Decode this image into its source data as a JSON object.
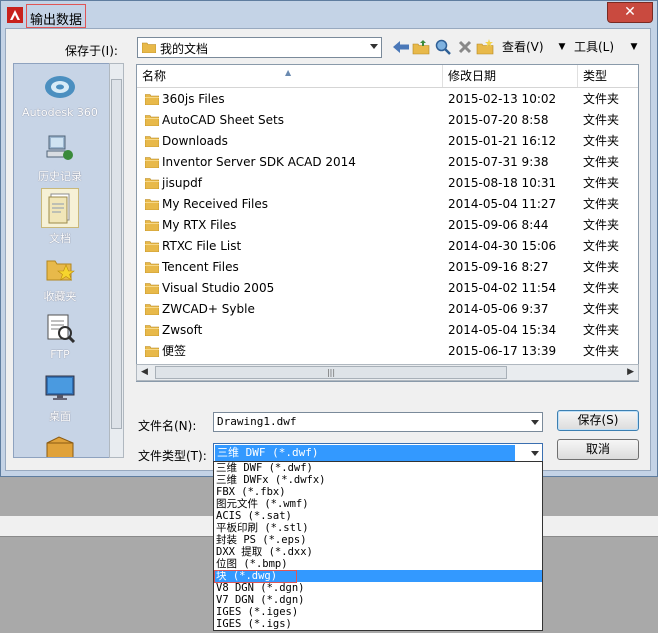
{
  "window": {
    "title": "输出数据",
    "close_glyph": "✕"
  },
  "toolbar": {
    "save_in_label": "保存于(I):",
    "current_folder": "我的文档",
    "view_label": "查看(V)",
    "tools_label": "工具(L)"
  },
  "places": [
    {
      "label": "Autodesk 360",
      "icon": "cloud-icon"
    },
    {
      "label": "历史记录",
      "icon": "history-icon"
    },
    {
      "label": "文档",
      "icon": "documents-icon",
      "active": true
    },
    {
      "label": "收藏夹",
      "icon": "favorites-icon"
    },
    {
      "label": "FTP",
      "icon": "ftp-icon"
    },
    {
      "label": "桌面",
      "icon": "desktop-icon"
    }
  ],
  "columns": {
    "name": "名称",
    "date": "修改日期",
    "type": "类型"
  },
  "files": [
    {
      "name": "360js Files",
      "date": "2015-02-13 10:02",
      "type": "文件夹"
    },
    {
      "name": "AutoCAD Sheet Sets",
      "date": "2015-07-20 8:58",
      "type": "文件夹"
    },
    {
      "name": "Downloads",
      "date": "2015-01-21 16:12",
      "type": "文件夹"
    },
    {
      "name": "Inventor Server SDK ACAD 2014",
      "date": "2015-07-31 9:38",
      "type": "文件夹"
    },
    {
      "name": "jisupdf",
      "date": "2015-08-18 10:31",
      "type": "文件夹"
    },
    {
      "name": "My Received Files",
      "date": "2014-05-04 11:27",
      "type": "文件夹"
    },
    {
      "name": "My RTX Files",
      "date": "2015-09-06 8:44",
      "type": "文件夹"
    },
    {
      "name": "RTXC File List",
      "date": "2014-04-30 15:06",
      "type": "文件夹"
    },
    {
      "name": "Tencent Files",
      "date": "2015-09-16 8:27",
      "type": "文件夹"
    },
    {
      "name": "Visual Studio 2005",
      "date": "2015-04-02 11:54",
      "type": "文件夹"
    },
    {
      "name": "ZWCAD+ Syble",
      "date": "2014-05-06 9:37",
      "type": "文件夹"
    },
    {
      "name": "Zwsoft",
      "date": "2014-05-04 15:34",
      "type": "文件夹"
    },
    {
      "name": "便签",
      "date": "2015-06-17 13:39",
      "type": "文件夹"
    }
  ],
  "form": {
    "filename_label": "文件名(N):",
    "filename_value": "Drawing1.dwf",
    "filetype_label": "文件类型(T):",
    "filetype_value": "三维 DWF (*.dwf)",
    "save_button": "保存(S)",
    "cancel_button": "取消"
  },
  "filetype_options": [
    "三维 DWF (*.dwf)",
    "三维 DWFx (*.dwfx)",
    "FBX (*.fbx)",
    "图元文件 (*.wmf)",
    "ACIS (*.sat)",
    "平板印刷 (*.stl)",
    "封装 PS (*.eps)",
    "DXX 提取 (*.dxx)",
    "位图 (*.bmp)",
    "块 (*.dwg)",
    "V8 DGN (*.dgn)",
    "V7 DGN (*.dgn)",
    "IGES (*.iges)",
    "IGES (*.igs)"
  ],
  "highlighted_option_index": 9,
  "colors": {
    "selection": "#3399ff",
    "annotation_box": "#e05555",
    "title_bar": "#c4d3e6",
    "close_button": "#c94a3f"
  }
}
